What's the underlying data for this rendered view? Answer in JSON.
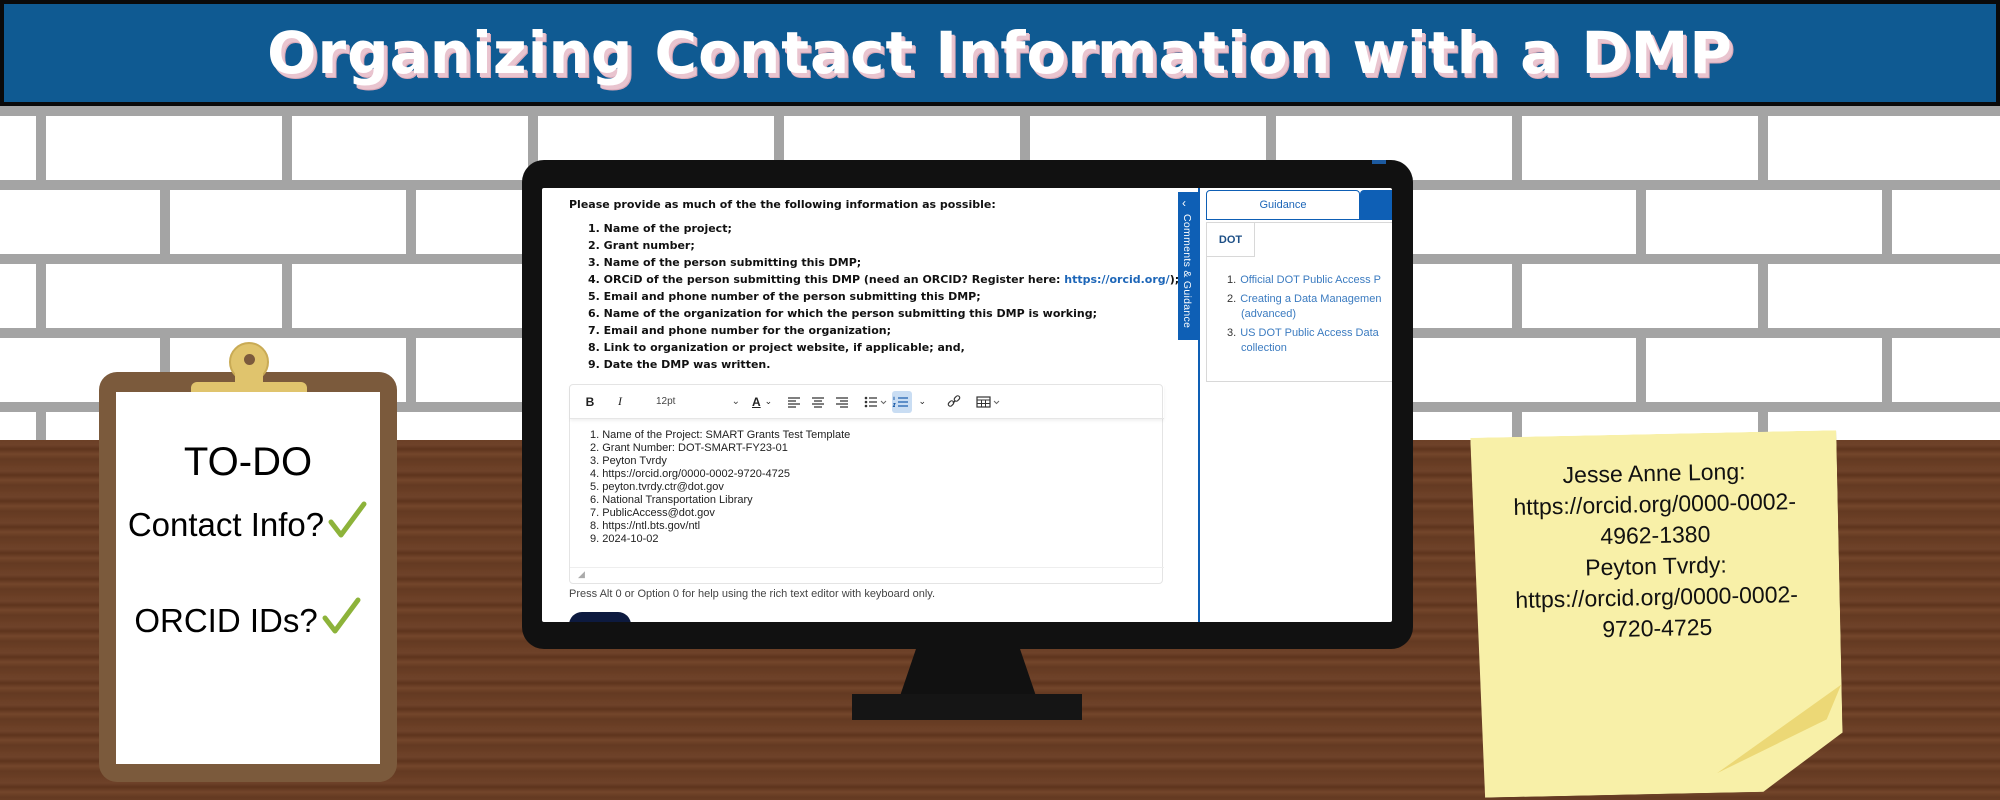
{
  "banner": {
    "title": "Organizing Contact Information with a DMP"
  },
  "clipboard": {
    "title": "TO-DO",
    "items": [
      {
        "label": "Contact Info?",
        "checked": true
      },
      {
        "label": "ORCID IDs?",
        "checked": true
      }
    ],
    "check_color": "#8db33a"
  },
  "screen": {
    "intro": "Please provide as much of the the following information as possible:",
    "requirements": [
      "1. Name of the project;",
      "2. Grant number;",
      "3. Name of the person submitting this DMP;",
      "4. ORCiD of the person submitting this DMP (need an ORCID? Register here: ",
      "5. Email and phone number of the person submitting this DMP;",
      "6. Name of the organization for which the person submitting this DMP is working;",
      "7. Email and phone number for the organization;",
      "8. Link to organization or project website, if applicable; and,",
      "9. Date the DMP was written."
    ],
    "orcid_link": "https://orcid.org/",
    "orcid_suffix": ");",
    "toolbar": {
      "bold": "B",
      "italic": "I",
      "font_size": "12pt",
      "font_color": "A"
    },
    "values": [
      "1. Name of the Project: SMART Grants Test Template",
      "2. Grant Number: DOT-SMART-FY23-01",
      "3. Peyton Tvrdy",
      "4. https://orcid.org/0000-0002-9720-4725",
      "5. peyton.tvrdy.ctr@dot.gov",
      "6. National Transportation Library",
      "7. PublicAccess@dot.gov",
      "8. https://ntl.bts.gov/ntl",
      "9. 2024-10-02"
    ],
    "help_text": "Press Alt 0 or Option 0 for help using the rich text editor with keyboard only.",
    "side_tab": "Comments & Guidance",
    "guidance": {
      "tab": "Guidance",
      "org_tab": "DOT",
      "links": [
        {
          "n": "1.",
          "lines": [
            "Official DOT Public Access P"
          ]
        },
        {
          "n": "2.",
          "lines": [
            "Creating a Data Managemen",
            "(advanced)"
          ]
        },
        {
          "n": "3.",
          "lines": [
            "US DOT Public Access Data",
            "collection"
          ]
        }
      ]
    },
    "accent_color": "#0e5fb5"
  },
  "sticky_note": {
    "lines": [
      "Jesse Anne Long:",
      "https://orcid.org/0000-0002-",
      "4962-1380",
      "Peyton Tvrdy:",
      "https://orcid.org/0000-0002-",
      "9720-4725"
    ]
  }
}
